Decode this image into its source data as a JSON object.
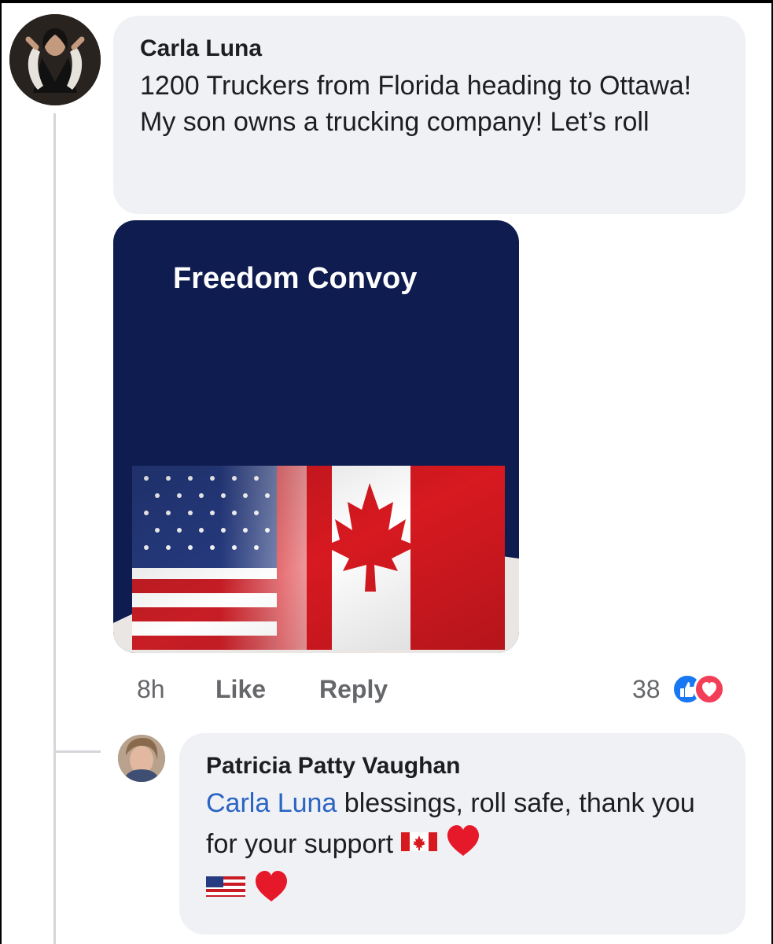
{
  "comment": {
    "author": "Carla Luna",
    "text": "1200 Truckers from Florida heading to Ottawa! My son owns a trucking company! Let’s roll",
    "card": {
      "title": "Freedom Convoy",
      "flags": [
        "us-flag-icon",
        "canada-flag-icon"
      ]
    },
    "actions": {
      "time": "8h",
      "like_label": "Like",
      "reply_label": "Reply"
    },
    "reactions": {
      "count": "38",
      "icons": [
        "like-reaction-icon",
        "love-reaction-icon"
      ]
    }
  },
  "reply": {
    "author": "Patricia Patty Vaughan",
    "mention": "Carla Luna",
    "text": " blessings, roll safe, thank you for your support",
    "emojis": [
      "canada-flag-icon",
      "red-heart-icon",
      "us-flag-icon",
      "red-heart-icon"
    ]
  },
  "colors": {
    "bubble": "#f0f1f4",
    "mention": "#2a64c4",
    "card_background": "#0e1c4f",
    "like": "#1877f2",
    "love": "#f33e58"
  }
}
